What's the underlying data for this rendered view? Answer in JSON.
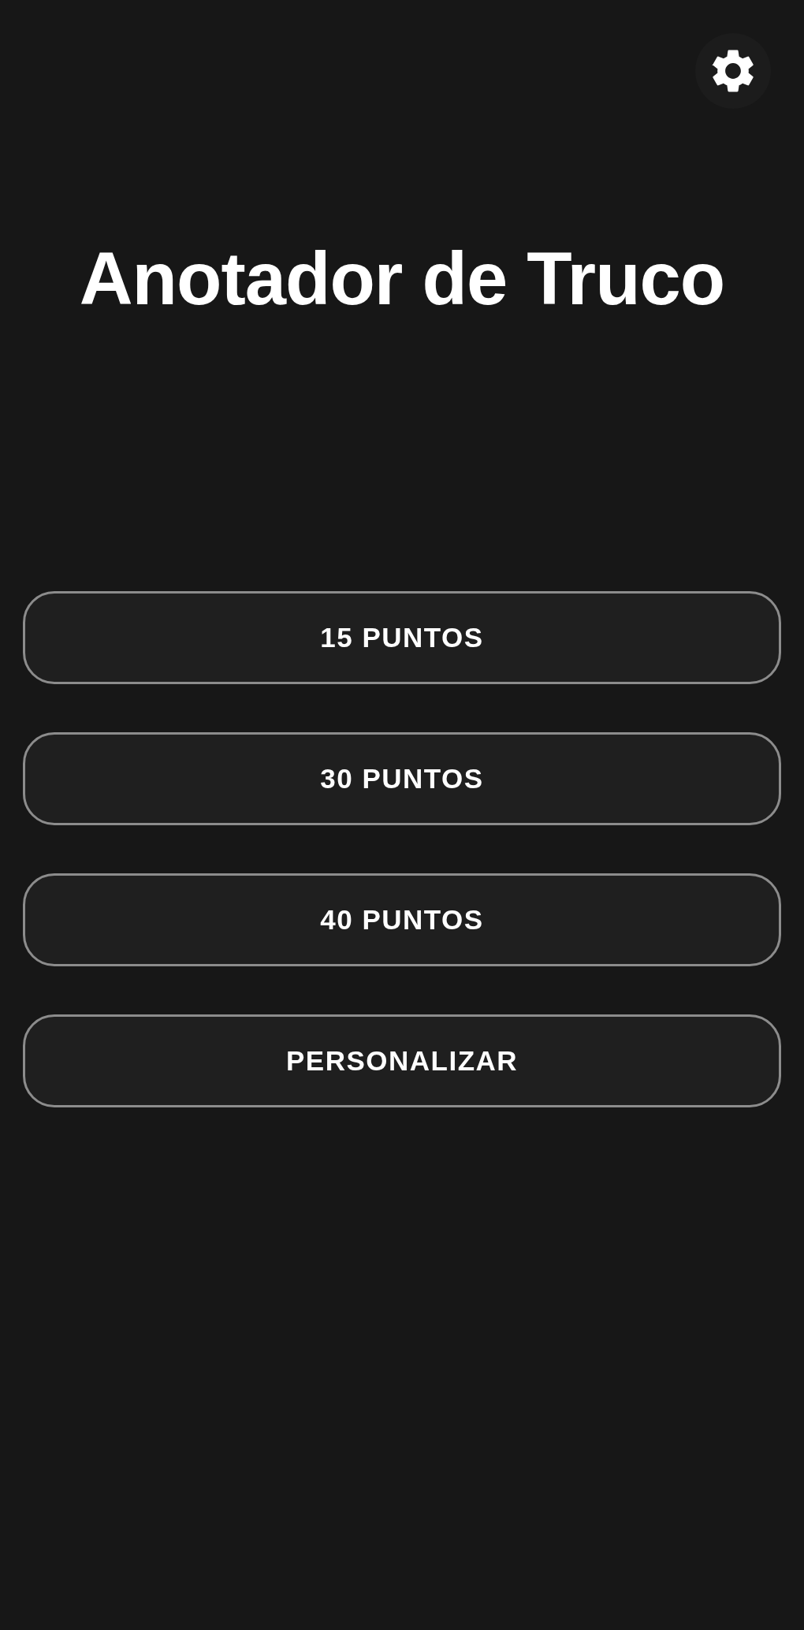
{
  "title": "Anotador de Truco",
  "buttons": [
    {
      "label": "15 PUNTOS"
    },
    {
      "label": "30 PUNTOS"
    },
    {
      "label": "40 PUNTOS"
    },
    {
      "label": "PERSONALIZAR"
    }
  ]
}
